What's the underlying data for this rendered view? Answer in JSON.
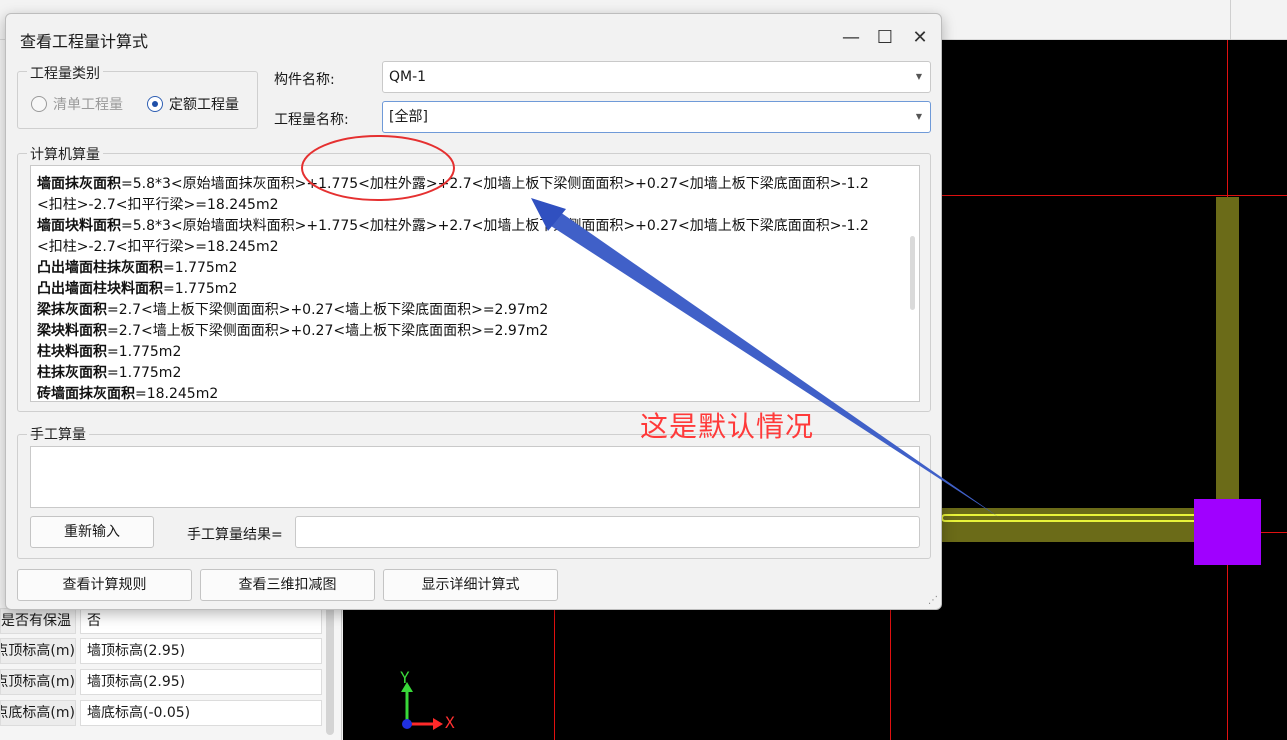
{
  "dialog": {
    "title": "查看工程量计算式",
    "window_buttons": {
      "minimize": "—",
      "maximize": "☐",
      "close": "✕"
    },
    "category_group": {
      "title": "工程量类别",
      "options": [
        {
          "label": "清单工程量",
          "selected": false,
          "enabled": false
        },
        {
          "label": "定额工程量",
          "selected": true,
          "enabled": true
        }
      ]
    },
    "component_name": {
      "label": "构件名称:",
      "value": "QM-1"
    },
    "quantity_name": {
      "label": "工程量名称:",
      "value": "[全部]"
    },
    "computer_calc": {
      "title": "计算机算量",
      "lines": [
        {
          "name": "墙面抹灰面积",
          "formula": "=5.8*3<原始墙面抹灰面积>+1.775<加柱外露>+2.7<加墙上板下梁侧面面积>+0.27<加墙上板下梁底面面积>-1.2"
        },
        {
          "name": "",
          "formula": "<扣柱>-2.7<扣平行梁>=18.245m2"
        },
        {
          "name": "墙面块料面积",
          "formula": "=5.8*3<原始墙面块料面积>+1.775<加柱外露>+2.7<加墙上板下梁侧面面积>+0.27<加墙上板下梁底面面积>-1.2"
        },
        {
          "name": "",
          "formula": "<扣柱>-2.7<扣平行梁>=18.245m2"
        },
        {
          "name": "凸出墙面柱抹灰面积",
          "formula": "=1.775m2"
        },
        {
          "name": "凸出墙面柱块料面积",
          "formula": "=1.775m2"
        },
        {
          "name": "梁抹灰面积",
          "formula": "=2.7<墙上板下梁侧面面积>+0.27<墙上板下梁底面面积>=2.97m2"
        },
        {
          "name": "梁块料面积",
          "formula": "=2.7<墙上板下梁侧面面积>+0.27<墙上板下梁底面面积>=2.97m2"
        },
        {
          "name": "柱块料面积",
          "formula": "=1.775m2"
        },
        {
          "name": "柱抹灰面积",
          "formula": "=1.775m2"
        },
        {
          "name": "砖墙面抹灰面积",
          "formula": "=18.245m2"
        }
      ]
    },
    "manual_calc": {
      "title": "手工算量",
      "reenter_button": "重新输入",
      "result_label": "手工算量结果=",
      "result_value": ""
    },
    "bottom_buttons": {
      "calc_rules": "查看计算规则",
      "view_3d": "查看三维扣减图",
      "show_detail": "显示详细计算式"
    }
  },
  "annotation": {
    "text": "这是默认情况",
    "color": "#ff3a3a"
  },
  "properties_panel": {
    "rows": [
      {
        "name": "是否有保温",
        "value": "否"
      },
      {
        "name": "起点顶标高(m)",
        "value": "墙顶标高(2.95)"
      },
      {
        "name": "终点顶标高(m)",
        "value": "墙顶标高(2.95)"
      },
      {
        "name": "起点底标高(m)",
        "value": "墙底标高(-0.05)"
      }
    ]
  },
  "canvas": {
    "axis_y": "Y",
    "axis_x": "X",
    "colors": {
      "background": "#000000",
      "grid_line": "#e01010",
      "wall": "#6b6b18",
      "selected_wall": "#e9f43a",
      "column": "#a000ff"
    }
  }
}
